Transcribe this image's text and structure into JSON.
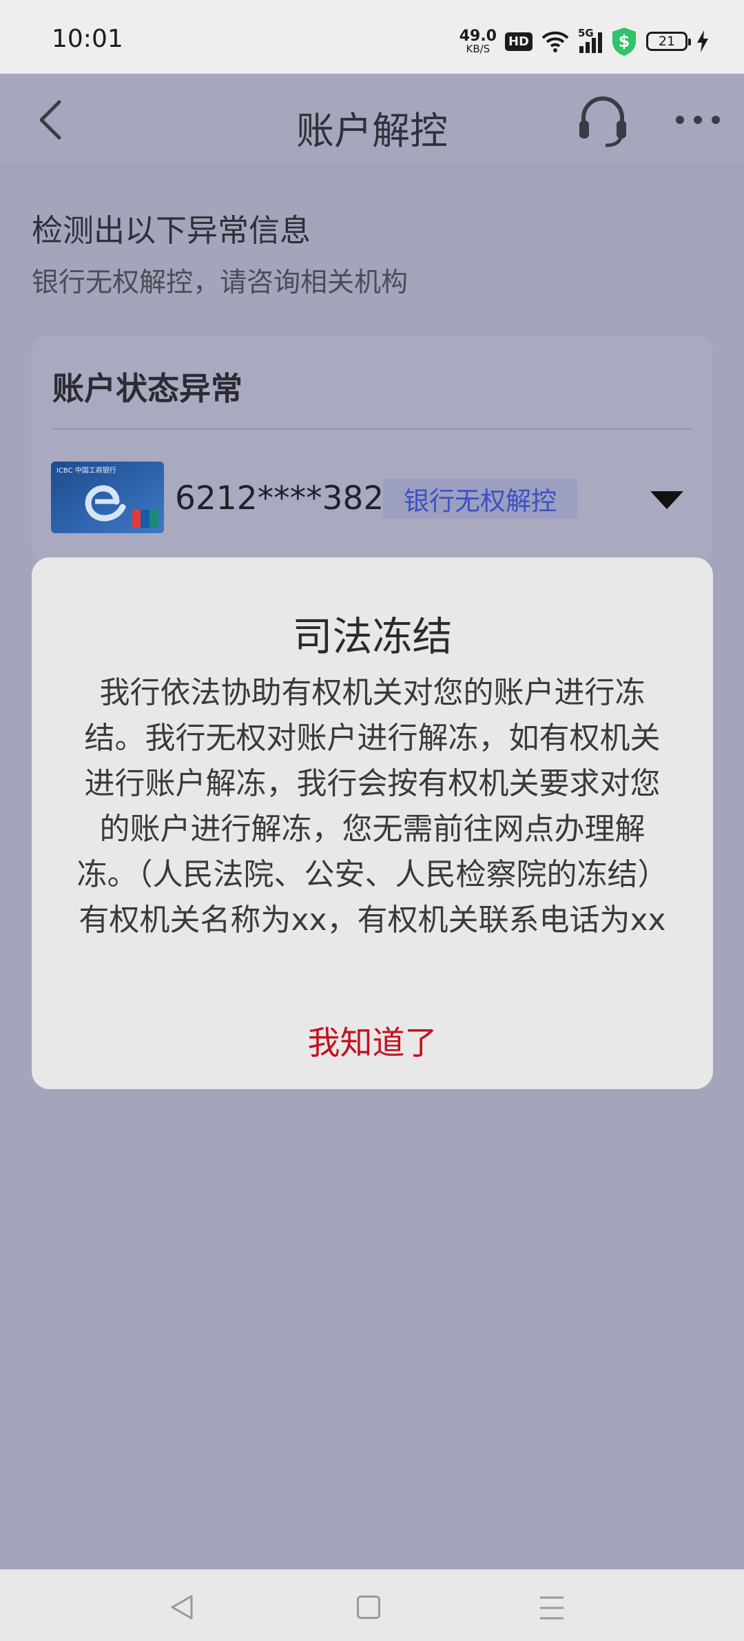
{
  "status_bar": {
    "time": "10:01",
    "net_speed_value": "49.0",
    "net_speed_unit": "KB/S",
    "hd_label": "HD",
    "network_label": "5G",
    "battery_level": "21"
  },
  "header": {
    "title": "账户解控",
    "back_icon": "chevron-left-icon",
    "support_icon": "headset-icon",
    "more_icon": "more-horizontal-icon"
  },
  "notice": {
    "title": "检测出以下异常信息",
    "subtitle": "银行无权解控，请咨询相关机构"
  },
  "card": {
    "title": "账户状态异常",
    "account_number": "6212****3828",
    "tag": "银行无权解控",
    "bank_card_text": "ICBC 中国工商银行",
    "expand_icon": "caret-down-icon"
  },
  "dialog": {
    "title": "司法冻结",
    "body": "我行依法协助有权机关对您的账户进行冻结。我行无权对账户进行解冻，如有权机关进行账户解冻，我行会按有权机关要求对您的账户进行解冻，您无需前往网点办理解冻。（人民法院、公安、人民检察院的冻结）有权机关名称为xx，有权机关联系电话为xx",
    "confirm": "我知道了"
  },
  "colors": {
    "accent_red": "#c3121f",
    "tag_text": "#3b52c4",
    "shield_green": "#2fc36b"
  }
}
